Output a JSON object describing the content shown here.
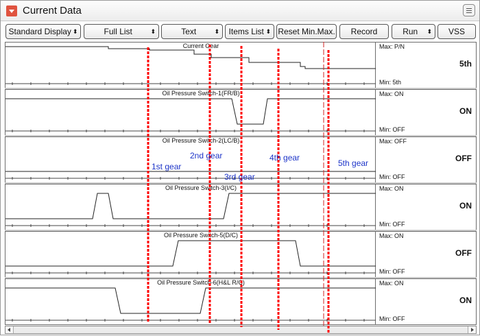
{
  "window": {
    "title": "Current Data"
  },
  "toolbar": {
    "buttons": [
      {
        "label": "Standard Display",
        "spinner": true
      },
      {
        "label": "Full List",
        "spinner": true
      },
      {
        "label": "Text",
        "spinner": true
      },
      {
        "label": "Items List",
        "spinner": true
      },
      {
        "label": "Reset Min.Max.",
        "spinner": false
      },
      {
        "label": "Record",
        "spinner": false
      },
      {
        "label": "Run",
        "spinner": true
      },
      {
        "label": "VSS",
        "spinner": false
      }
    ]
  },
  "panels": [
    {
      "name": "Current Gear",
      "max": "Max: P/N",
      "min": "Min: 5th",
      "value": "5th"
    },
    {
      "name": "Oil Pressure Switch-1(FR/B)",
      "max": "Max: ON",
      "min": "Min: OFF",
      "value": "ON"
    },
    {
      "name": "Oil Pressure Switch-2(LC/B)",
      "max": "Max: OFF",
      "min": "Min: OFF",
      "value": "OFF"
    },
    {
      "name": "Oil Pressure Switch-3(I/C)",
      "max": "Max: ON",
      "min": "Min: OFF",
      "value": "ON"
    },
    {
      "name": "Oil Pressure Switch-5(D/C)",
      "max": "Max: ON",
      "min": "Min: OFF",
      "value": "OFF"
    },
    {
      "name": "Oil Pressure Switch-6(H&L R/C)",
      "max": "Max: ON",
      "min": "Min: OFF",
      "value": "ON"
    }
  ],
  "annotations": {
    "gear_labels": [
      "1st gear",
      "2nd gear",
      "3rd gear",
      "4th gear",
      "5th gear"
    ],
    "marker_color": "#ff0000",
    "label_color": "#1d34c8"
  },
  "icons": {
    "title": "dropdown-arrow-icon",
    "menu": "list-menu-icon",
    "scroll_left": "arrow-left-icon",
    "scroll_right": "arrow-right-icon"
  }
}
